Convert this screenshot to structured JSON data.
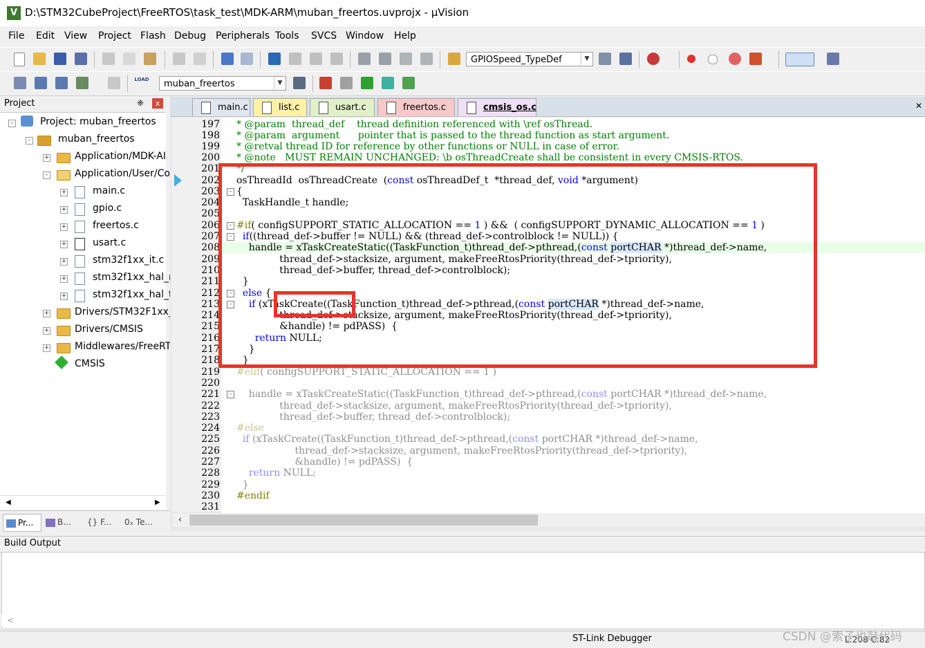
{
  "window": {
    "title": "D:\\STM32CubeProject\\FreeRTOS\\task_test\\MDK-ARM\\muban_freertos.uvprojx - µVision",
    "app_icon": "V"
  },
  "menu": [
    "File",
    "Edit",
    "View",
    "Project",
    "Flash",
    "Debug",
    "Peripherals",
    "Tools",
    "SVCS",
    "Window",
    "Help"
  ],
  "toolbar1": {
    "find_combo": "GPIOSpeed_TypeDef"
  },
  "toolbar2": {
    "target_combo": "muban_freertos",
    "load_label": "LOAD"
  },
  "project_pane": {
    "title": "Project",
    "pin": "❈",
    "close": "x",
    "tree": [
      {
        "label": "Project: muban_freertos",
        "icon": "project-icon"
      },
      {
        "label": "muban_freertos",
        "icon": "target-icon"
      },
      {
        "label": "Application/MDK-AI",
        "icon": "folder-icon"
      },
      {
        "label": "Application/User/Co",
        "icon": "folder-icon"
      },
      {
        "label": "main.c",
        "icon": "file-icon"
      },
      {
        "label": "gpio.c",
        "icon": "file-icon"
      },
      {
        "label": "freertos.c",
        "icon": "file-icon"
      },
      {
        "label": "usart.c",
        "icon": "file-icon"
      },
      {
        "label": "stm32f1xx_it.c",
        "icon": "file-icon"
      },
      {
        "label": "stm32f1xx_hal_n",
        "icon": "file-icon"
      },
      {
        "label": "stm32f1xx_hal_ti",
        "icon": "file-icon"
      },
      {
        "label": "Drivers/STM32F1xx_",
        "icon": "folder-icon"
      },
      {
        "label": "Drivers/CMSIS",
        "icon": "folder-icon"
      },
      {
        "label": "Middlewares/FreeRT",
        "icon": "folder-icon"
      },
      {
        "label": "CMSIS",
        "icon": "cmsis-icon"
      }
    ],
    "bottom_tabs": [
      "Pr...",
      "B...",
      "{} F...",
      "0ₓ Te..."
    ]
  },
  "editor": {
    "tabs": [
      {
        "label": "main.c",
        "color": "#dfe6ef"
      },
      {
        "label": "list.c",
        "color": "#fff2a8"
      },
      {
        "label": "usart.c",
        "color": "#e2f0c8"
      },
      {
        "label": "freertos.c",
        "color": "#f6c8c8"
      },
      {
        "label": "cmsis_os.c",
        "color": "#eee0f6"
      }
    ],
    "line_numbers": [
      "197",
      "198",
      "199",
      "200",
      "201",
      "202",
      "203",
      "204",
      "205",
      "206",
      "207",
      "208",
      "209",
      "210",
      "211",
      "212",
      "213",
      "214",
      "215",
      "216",
      "217",
      "218",
      "219",
      "220",
      "221",
      "222",
      "223",
      "224",
      "225",
      "226",
      "227",
      "228",
      "229",
      "230",
      "231"
    ]
  },
  "build_output": {
    "title": "Build Output",
    "scroll_left": "<"
  },
  "status": {
    "debugger": "ST-Link Debugger",
    "position": "L:208 C:82"
  },
  "watermark": "CSDN @索子也敲代码"
}
